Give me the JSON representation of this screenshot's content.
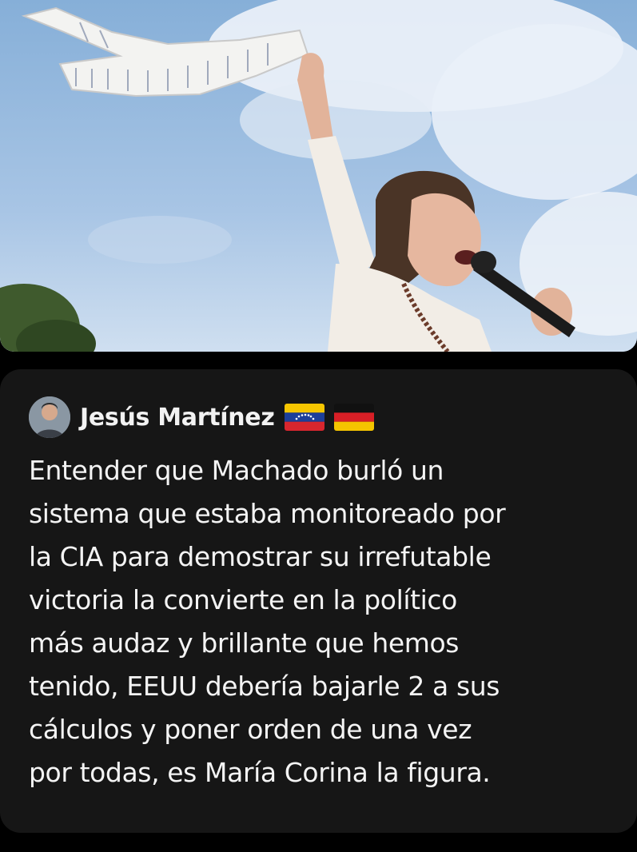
{
  "post": {
    "author": {
      "name": "Jesús Martínez",
      "flags": [
        "venezuela-flag-icon",
        "germany-flag-icon"
      ]
    },
    "text_lines": [
      "Entender que Machado burló un",
      "sistema que estaba monitoreado por",
      "la CIA para demostrar su irrefutable",
      "victoria la convierte en la político",
      "más audaz y brillante que hemos",
      "tenido, EEUU debería bajarle 2 a sus",
      "cálculos y poner orden de una vez",
      "por todas, es María Corina la figura."
    ]
  },
  "colors": {
    "background": "#000000",
    "card": "#161616",
    "text": "#f4f4f4"
  }
}
